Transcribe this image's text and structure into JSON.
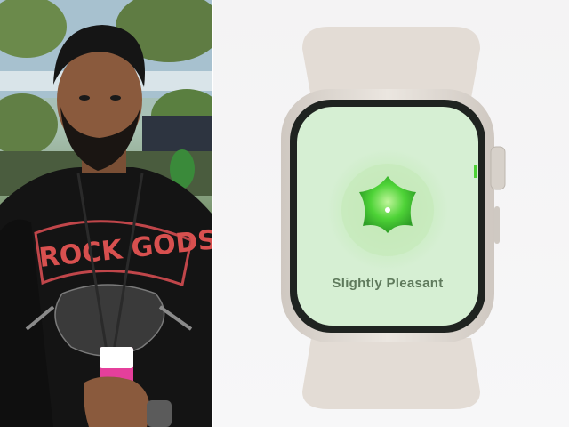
{
  "left_photo": {
    "subject": "man-in-black-sweatshirt",
    "shirt_print": "ROCK GODS",
    "lanyard_color": "#e53f9b"
  },
  "watch_screen": {
    "mood_label": "Slightly Pleasant",
    "mood_color": "#4ed337",
    "screen_background": "#d6efd3"
  },
  "colors": {
    "watch_case": "#d9d4cd",
    "watch_band": "#e3dcd5",
    "screen_bezel": "#1f2320"
  }
}
